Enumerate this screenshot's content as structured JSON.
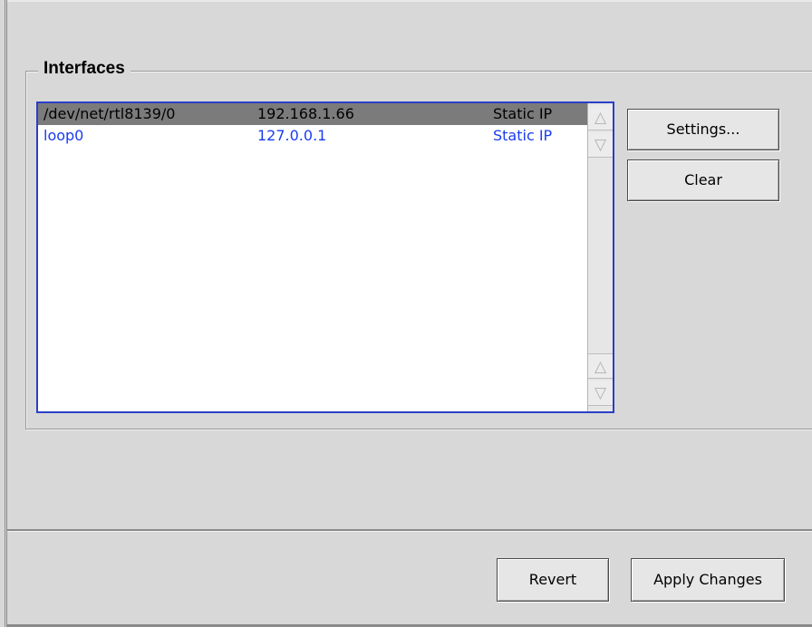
{
  "interfaces_group": {
    "title": "Interfaces",
    "list": {
      "rows": [
        {
          "device": "/dev/net/rtl8139/0",
          "address": "192.168.1.66",
          "type": "Static IP",
          "selected": true
        },
        {
          "device": "loop0",
          "address": "127.0.0.1",
          "type": "Static IP",
          "selected": false
        }
      ]
    },
    "scrollbar": {
      "up_glyph": "△",
      "down_glyph": "▽"
    },
    "buttons": {
      "settings_label": "Settings...",
      "clear_label": "Clear"
    }
  },
  "footer": {
    "revert_label": "Revert",
    "apply_label": "Apply Changes"
  },
  "colors": {
    "list_border": "#2a3fc8",
    "selected_row_bg": "#7b7b7b",
    "unselected_text": "#1a3cf0",
    "window_bg": "#d8d8d8"
  }
}
